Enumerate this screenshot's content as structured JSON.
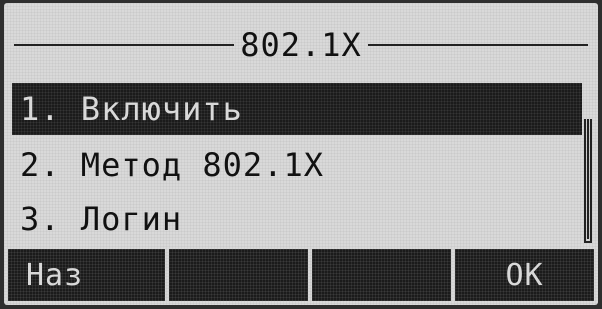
{
  "screen": {
    "title": "802.1X"
  },
  "menu": {
    "items": [
      {
        "label": "1. Включить",
        "selected": true
      },
      {
        "label": "2. Метод 802.1X",
        "selected": false
      },
      {
        "label": "3. Логин",
        "selected": false
      }
    ]
  },
  "softkeys": [
    {
      "label": "Наз"
    },
    {
      "label": ""
    },
    {
      "label": ""
    },
    {
      "label": "OK"
    }
  ]
}
